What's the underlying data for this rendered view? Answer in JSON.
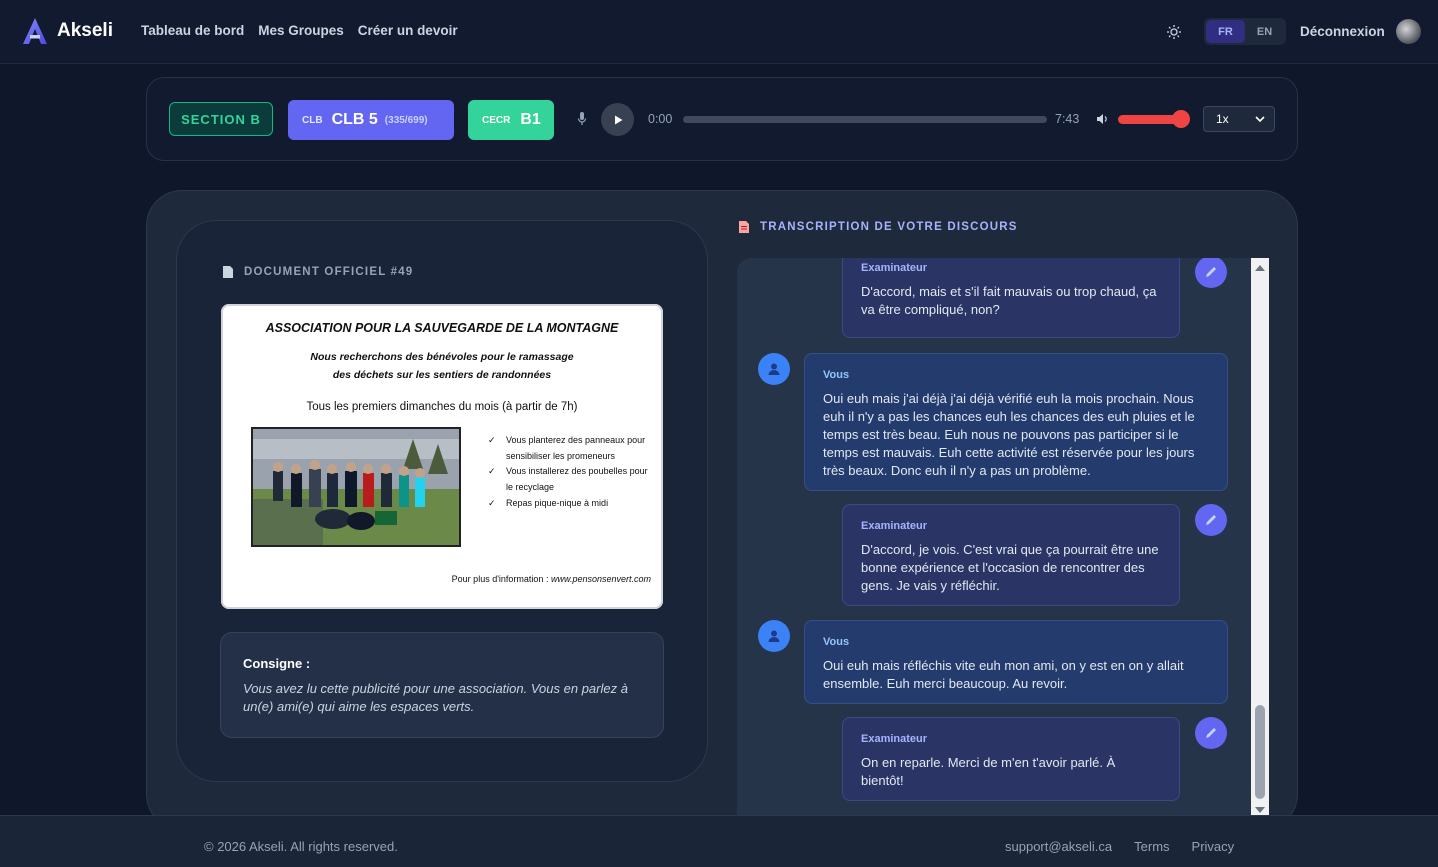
{
  "brand": {
    "name": "Akseli"
  },
  "nav": {
    "dashboard": "Tableau de bord",
    "groups": "Mes Groupes",
    "create": "Créer un devoir"
  },
  "lang": {
    "fr": "FR",
    "en": "EN",
    "active": "FR"
  },
  "logout": "Déconnexion",
  "player": {
    "section": "SECTION B",
    "clb_small": "CLB",
    "clb_value": "CLB 5",
    "clb_score": "(335/699)",
    "cecr_small": "CECR",
    "cecr_value": "B1",
    "current_time": "0:00",
    "total_time": "7:43",
    "speed": "1x",
    "progress": 0,
    "volume": 1.0
  },
  "document": {
    "heading": "DOCUMENT OFFICIEL #49",
    "flyer": {
      "title": "ASSOCIATION POUR LA SAUVEGARDE DE LA MONTAGNE",
      "subtitle_1": "Nous recherchons des bénévoles pour le ramassage",
      "subtitle_2": "des déchets sur les sentiers de randonnées",
      "when": "Tous les premiers dimanches du mois (à partir de 7h)",
      "bullets": [
        "Vous planterez des panneaux pour sensibiliser les promeneurs",
        "Vous installerez des poubelles pour le recyclage",
        "Repas pique-nique à midi"
      ],
      "footer_label": "Pour plus d'information : ",
      "footer_url": "www.pensonsenvert.com"
    },
    "consigne_label": "Consigne :",
    "consigne_text": "Vous avez lu cette publicité pour une association. Vous en parlez à un(e) ami(e) qui aime les espaces verts."
  },
  "transcript": {
    "heading": "TRANSCRIPTION DE VOTRE DISCOURS",
    "messages": [
      {
        "speaker": "Examinateur",
        "text": "D'accord, mais et s'il fait mauvais ou trop chaud, ça va être compliqué, non?"
      },
      {
        "speaker": "Vous",
        "text": "Oui euh mais j'ai déjà j'ai déjà vérifié euh la mois prochain. Nous euh il n'y a pas les chances euh les chances des euh pluies et le temps est très beau. Euh nous ne pouvons pas participer si le temps est mauvais. Euh cette activité est réservée pour les jours très beaux. Donc euh il n'y a pas un problème."
      },
      {
        "speaker": "Examinateur",
        "text": "D'accord, je vois. C'est vrai que ça pourrait être une bonne expérience et l'occasion de rencontrer des gens. Je vais y réfléchir."
      },
      {
        "speaker": "Vous",
        "text": "Oui euh mais réfléchis vite euh mon ami, on y est en on y allait ensemble. Euh merci beaucoup. Au revoir."
      },
      {
        "speaker": "Examinateur",
        "text": "On en reparle. Merci de m'en t'avoir parlé. À bientôt!"
      }
    ]
  },
  "footer": {
    "copyright": "© 2026 Akseli. All rights reserved.",
    "support": "support@akseli.ca",
    "terms": "Terms",
    "privacy": "Privacy"
  },
  "colors": {
    "accent": "#6366f1",
    "success": "#34d399",
    "danger": "#ef4444",
    "bg": "#0f172a"
  }
}
